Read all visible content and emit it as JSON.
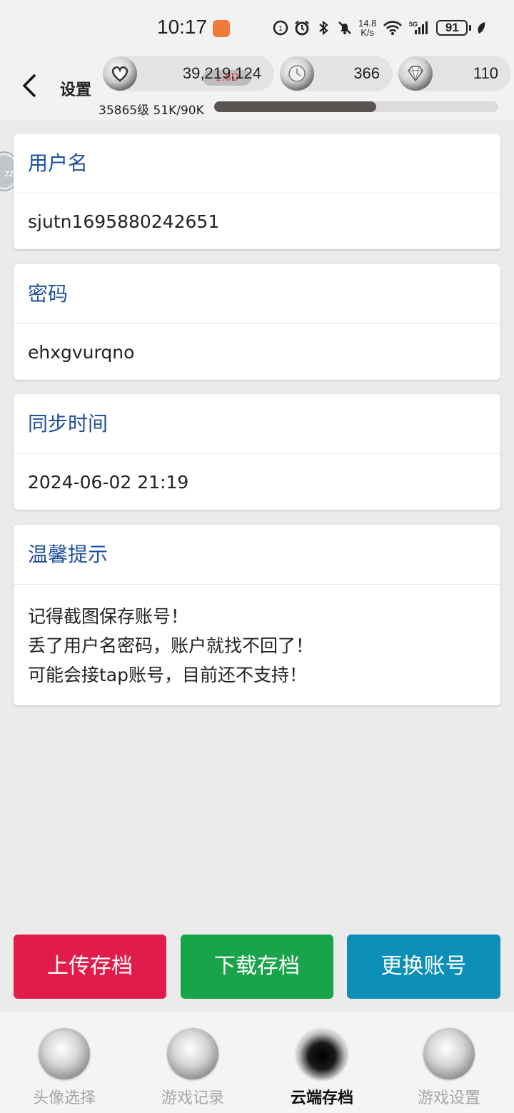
{
  "status_bar": {
    "time": "10:17",
    "net_speed_top": "14.8",
    "net_speed_bottom": "K/s",
    "battery": "91"
  },
  "header": {
    "back_icon": "chevron-left-icon",
    "title": "设置",
    "currency": [
      {
        "icon": "heart-coin-icon",
        "value": "39,219,124"
      },
      {
        "icon": "clock-coin-icon",
        "value": "366"
      },
      {
        "icon": "diamond-coin-icon",
        "value": "110"
      }
    ],
    "overlay_badge": "1.6D",
    "level_text": "35865级 51K/90K",
    "xp_progress": 0.57
  },
  "cards": {
    "username": {
      "label": "用户名",
      "value": "sjutn1695880242651"
    },
    "password": {
      "label": "密码",
      "value": "ehxgvurqno"
    },
    "sync_time": {
      "label": "同步时间",
      "value": "2024-06-02 21:19"
    },
    "tips": {
      "label": "温馨提示",
      "lines": [
        "记得截图保存账号！",
        "丢了用户名密码，账户就找不回了！",
        "可能会接tap账号，目前还不支持！"
      ]
    }
  },
  "actions": {
    "upload": {
      "label": "上传存档",
      "color": "#e21c4a"
    },
    "download": {
      "label": "下载存档",
      "color": "#19a34a"
    },
    "switch": {
      "label": "更换账号",
      "color": "#0b8fb7"
    }
  },
  "bottom_nav": [
    {
      "label": "头像选择",
      "active": false
    },
    {
      "label": "游戏记录",
      "active": false
    },
    {
      "label": "云端存档",
      "active": true
    },
    {
      "label": "游戏设置",
      "active": false
    }
  ],
  "side_badge": "zz"
}
